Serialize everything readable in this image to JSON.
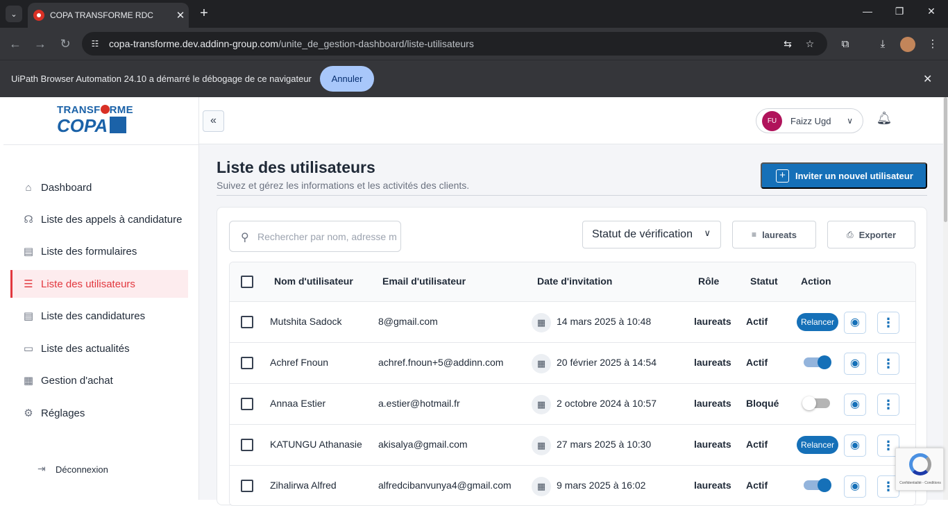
{
  "browser": {
    "tab_title": "COPA TRANSFORME RDC",
    "url_domain": "copa-transforme.dev.addinn-group.com",
    "url_path": "/unite_de_gestion-dashboard/liste-utilisateurs"
  },
  "infobar": {
    "message": "UiPath Browser Automation 24.10 a démarré le débogage de ce navigateur",
    "cancel_label": "Annuler"
  },
  "logo": {
    "line1_a": "TRANSF",
    "line1_b": "RME",
    "line2": "COPA"
  },
  "sidebar": {
    "items": [
      {
        "label": "Dashboard",
        "icon": "home-icon"
      },
      {
        "label": "Liste des appels à candidature",
        "icon": "megaphone-icon"
      },
      {
        "label": "Liste des formulaires",
        "icon": "form-icon"
      },
      {
        "label": "Liste des utilisateurs",
        "icon": "users-list-icon",
        "active": true
      },
      {
        "label": "Liste des candidatures",
        "icon": "document-icon"
      },
      {
        "label": "Liste des actualités",
        "icon": "news-icon"
      },
      {
        "label": "Gestion d'achat",
        "icon": "receipt-icon"
      },
      {
        "label": "Réglages",
        "icon": "gear-icon"
      }
    ],
    "logout_label": "Déconnexion"
  },
  "topbar": {
    "user_initials": "FU",
    "user_name": "Faizz Ugd"
  },
  "page": {
    "title": "Liste des utilisateurs",
    "subtitle": "Suivez et gérez les informations et les activités des clients.",
    "invite_label": "Inviter un nouvel utilisateur"
  },
  "filters": {
    "search_placeholder": "Rechercher par nom, adresse mail",
    "status_select": "Statut de vérification",
    "role_filter": "laureats",
    "export_label": "Exporter"
  },
  "table": {
    "headers": {
      "name": "Nom d'utilisateur",
      "email": "Email d'utilisateur",
      "date": "Date d'invitation",
      "role": "Rôle",
      "status": "Statut",
      "action": "Action"
    },
    "rows": [
      {
        "name": "Mutshita Sadock",
        "email": "8@gmail.com",
        "date": "14 mars 2025 à 10:48",
        "role": "laureats",
        "status": "Actif",
        "action": "relancer"
      },
      {
        "name": "Achref Fnoun",
        "email": "achref.fnoun+5@addinn.com",
        "date": "20 février 2025 à 14:54",
        "role": "laureats",
        "status": "Actif",
        "action": "toggle-on"
      },
      {
        "name": "Annaa Estier",
        "email": "a.estier@hotmail.fr",
        "date": "2 octobre 2024 à 10:57",
        "role": "laureats",
        "status": "Bloqué",
        "action": "toggle-off"
      },
      {
        "name": "KATUNGU Athanasie",
        "email": "akisalya@gmail.com",
        "date": "27 mars 2025 à 10:30",
        "role": "laureats",
        "status": "Actif",
        "action": "relancer"
      },
      {
        "name": "Zihalirwa Alfred",
        "email": "alfredcibanvunya4@gmail.com",
        "date": "9 mars 2025 à 16:02",
        "role": "laureats",
        "status": "Actif",
        "action": "toggle-on"
      }
    ],
    "relancer_label": "Relancer"
  },
  "recaptcha": {
    "text": "Confidentialité - Conditions"
  },
  "colors": {
    "primary": "#1570b8",
    "active_menu": "#e2383f",
    "avatar": "#b0135b"
  }
}
